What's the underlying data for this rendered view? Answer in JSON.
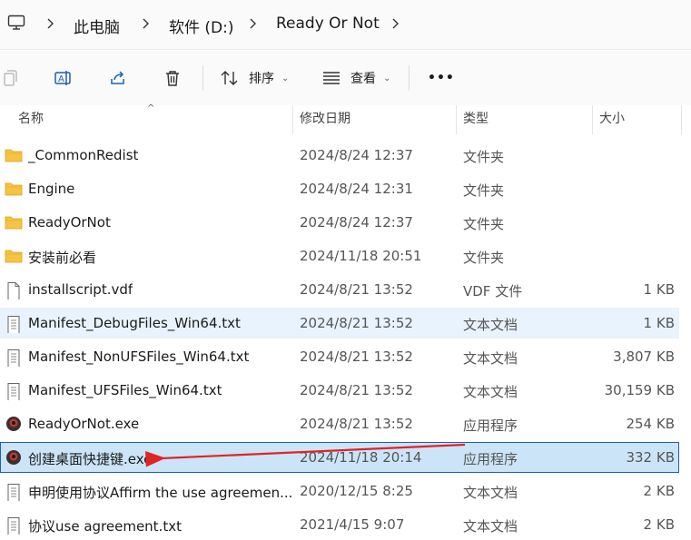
{
  "breadcrumb": {
    "items": [
      "此电脑",
      "软件 (D:)",
      "Ready Or Not"
    ]
  },
  "toolbar": {
    "sort_label": "排序",
    "view_label": "查看",
    "more_label": "•••"
  },
  "columns": {
    "name": "名称",
    "date": "修改日期",
    "type": "类型",
    "size": "大小"
  },
  "files": [
    {
      "name": "_CommonRedist",
      "date": "2024/8/24 12:37",
      "type": "文件夹",
      "size": "",
      "icon": "folder-icon"
    },
    {
      "name": "Engine",
      "date": "2024/8/24 12:31",
      "type": "文件夹",
      "size": "",
      "icon": "folder-icon"
    },
    {
      "name": "ReadyOrNot",
      "date": "2024/8/24 12:37",
      "type": "文件夹",
      "size": "",
      "icon": "folder-icon"
    },
    {
      "name": "安装前必看",
      "date": "2024/11/18 20:51",
      "type": "文件夹",
      "size": "",
      "icon": "folder-icon"
    },
    {
      "name": "installscript.vdf",
      "date": "2024/8/21 13:52",
      "type": "VDF 文件",
      "size": "1 KB",
      "icon": "file-icon"
    },
    {
      "name": "Manifest_DebugFiles_Win64.txt",
      "date": "2024/8/21 13:52",
      "type": "文本文档",
      "size": "1 KB",
      "icon": "text-file-icon"
    },
    {
      "name": "Manifest_NonUFSFiles_Win64.txt",
      "date": "2024/8/21 13:52",
      "type": "文本文档",
      "size": "3,807 KB",
      "icon": "text-file-icon"
    },
    {
      "name": "Manifest_UFSFiles_Win64.txt",
      "date": "2024/8/21 13:52",
      "type": "文本文档",
      "size": "30,159 KB",
      "icon": "text-file-icon"
    },
    {
      "name": "ReadyOrNot.exe",
      "date": "2024/8/21 13:52",
      "type": "应用程序",
      "size": "254 KB",
      "icon": "app-icon"
    },
    {
      "name": "创建桌面快捷键.exe",
      "date": "2024/11/18 20:14",
      "type": "应用程序",
      "size": "332 KB",
      "icon": "app-icon"
    },
    {
      "name": "申明使用协议Affirm the use agreemen...",
      "date": "2020/12/15 8:25",
      "type": "文本文档",
      "size": "2 KB",
      "icon": "text-file-icon"
    },
    {
      "name": "协议use agreement.txt",
      "date": "2021/4/15 9:07",
      "type": "文本文档",
      "size": "2 KB",
      "icon": "text-file-icon"
    }
  ],
  "hovered_row": "Manifest_DebugFiles_Win64.txt",
  "selected_row": "创建桌面快捷键.exe",
  "colors": {
    "folder": "#f6c343",
    "selection": "#cce4f7",
    "annotation_arrow": "#e02424"
  }
}
